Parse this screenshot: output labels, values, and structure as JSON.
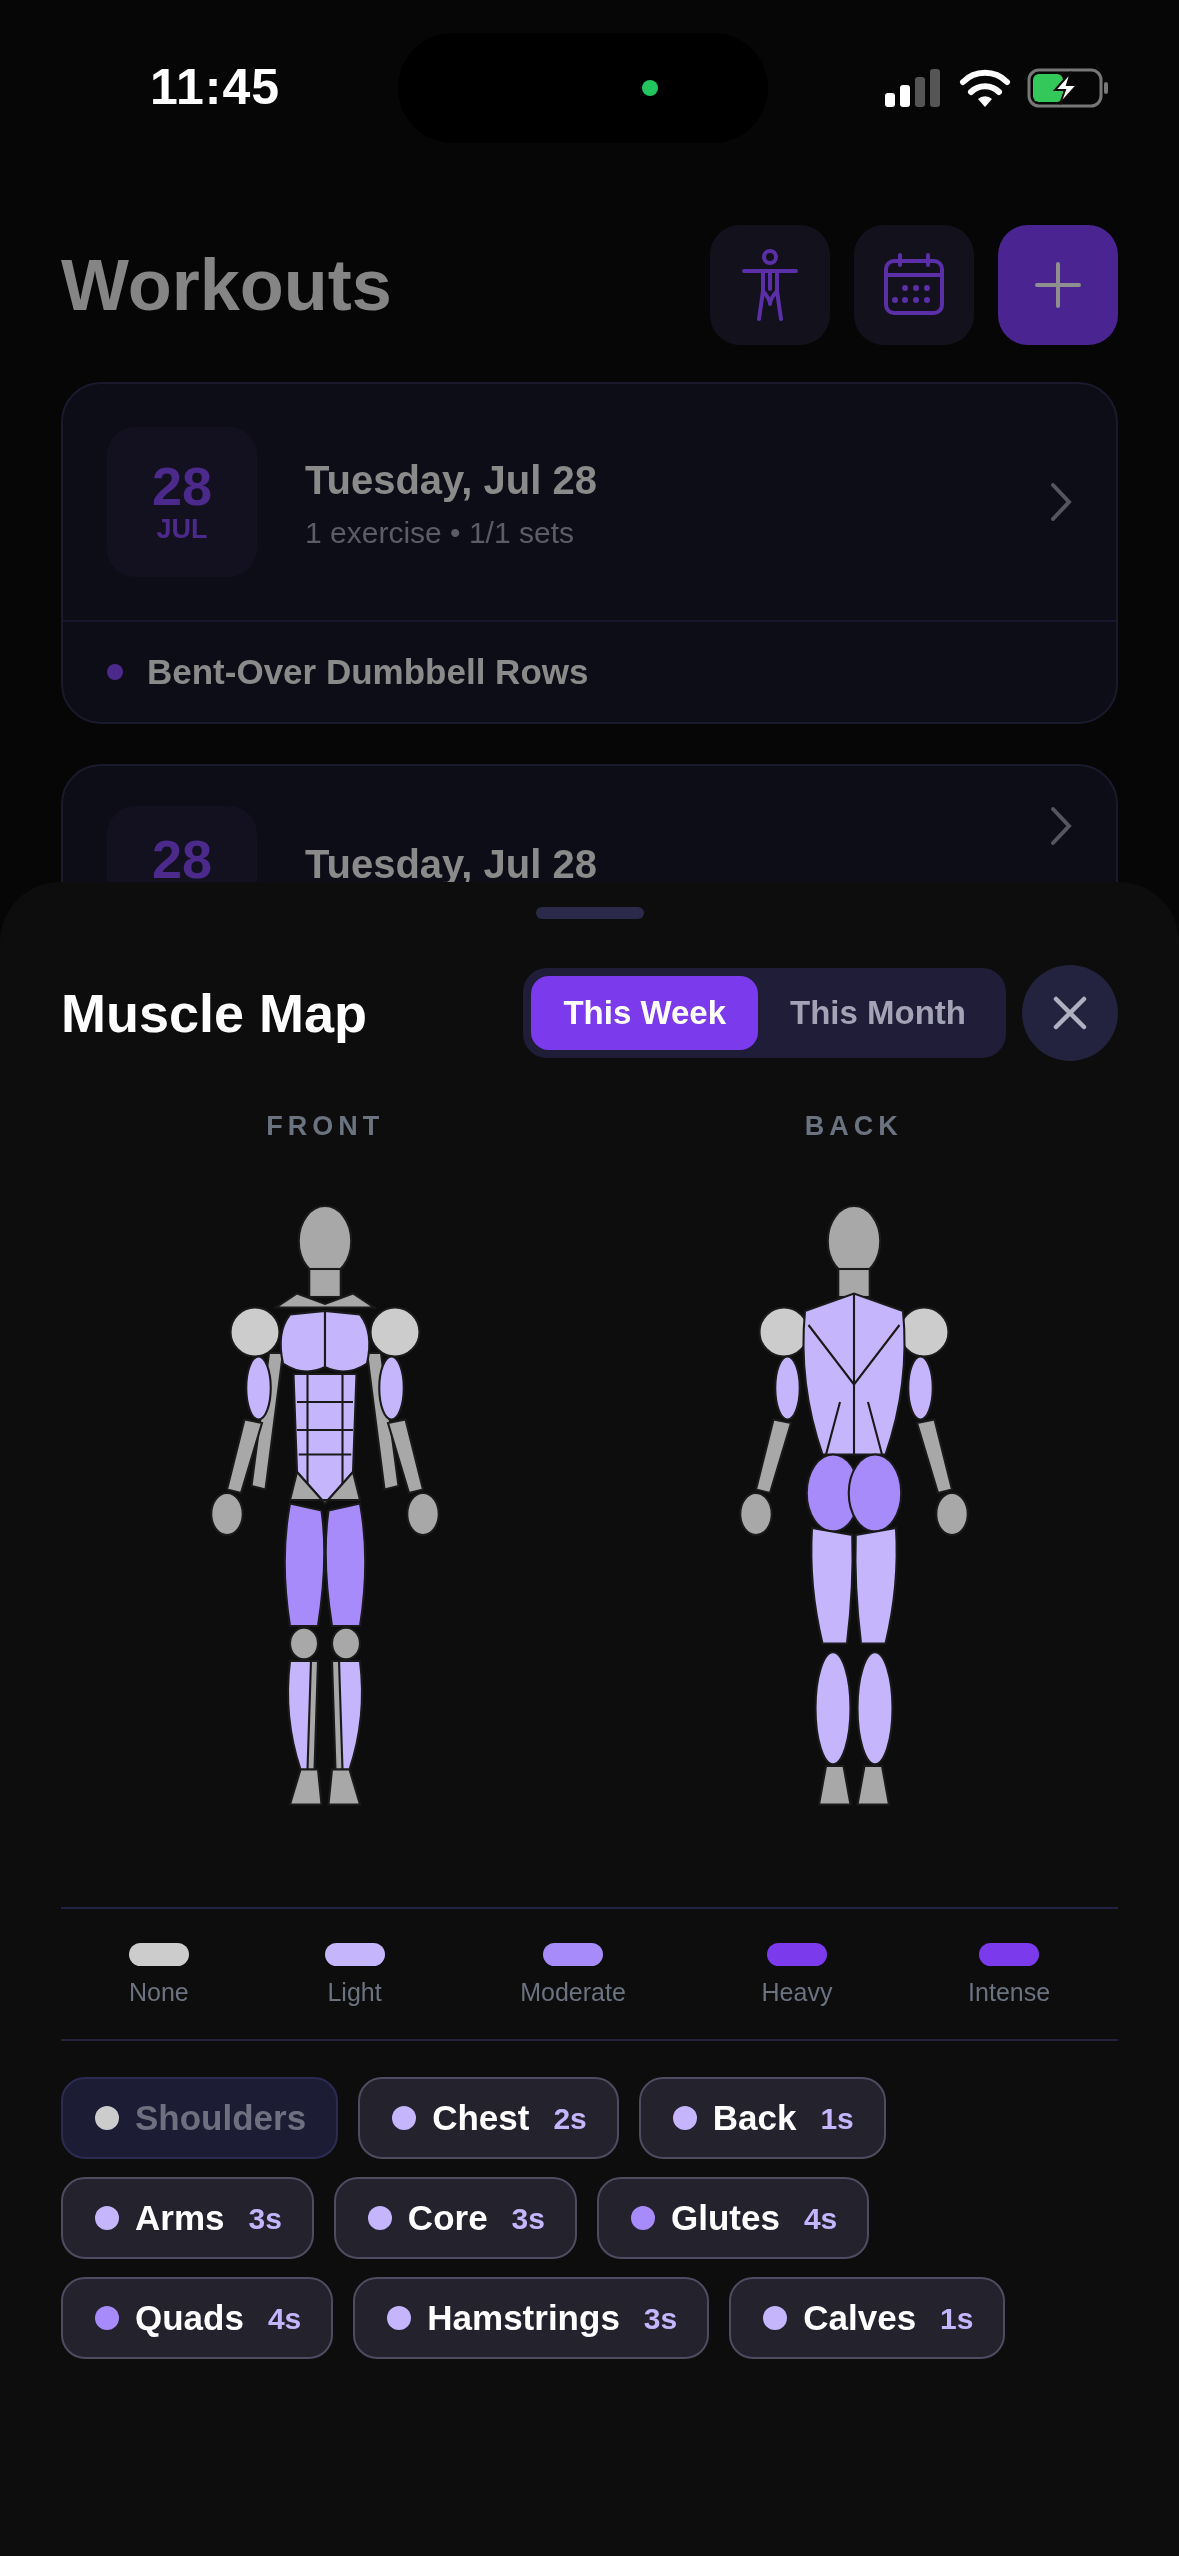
{
  "status_bar": {
    "time": "11:45"
  },
  "header": {
    "title": "Workouts",
    "buttons": [
      {
        "kind": "body"
      },
      {
        "kind": "calendar"
      },
      {
        "kind": "add"
      }
    ]
  },
  "workouts": [
    {
      "day": "28",
      "month": "JUL",
      "title": "Tuesday, Jul 28",
      "summary": "1 exercise • 1/1 sets",
      "exercises": [
        "Bent-Over Dumbbell Rows"
      ]
    },
    {
      "day": "28",
      "title": "Tuesday, Jul 28"
    }
  ],
  "muscle_map": {
    "title": "Muscle Map",
    "tabs": [
      {
        "label": "This Week",
        "selected": true
      },
      {
        "label": "This Month",
        "selected": false
      }
    ],
    "views": [
      "FRONT",
      "BACK"
    ],
    "legend": [
      {
        "label": "None",
        "color": "#cccccc"
      },
      {
        "label": "Light",
        "color": "#c4b5fd"
      },
      {
        "label": "Moderate",
        "color": "#a78bfa"
      },
      {
        "label": "Heavy",
        "color": "#7c3aed"
      },
      {
        "label": "Intense",
        "color": "#7c3aed"
      }
    ],
    "muscles": [
      {
        "name": "Shoulders",
        "color": "#cccccc",
        "trained": false
      },
      {
        "name": "Chest",
        "count": "2s",
        "color": "#c4b5fd",
        "trained": true
      },
      {
        "name": "Back",
        "count": "1s",
        "color": "#c4b5fd",
        "trained": true
      },
      {
        "name": "Arms",
        "count": "3s",
        "color": "#c4b5fd",
        "trained": true
      },
      {
        "name": "Core",
        "count": "3s",
        "color": "#c4b5fd",
        "trained": true
      },
      {
        "name": "Glutes",
        "count": "4s",
        "color": "#a78bfa",
        "trained": true
      },
      {
        "name": "Quads",
        "count": "4s",
        "color": "#a78bfa",
        "trained": true
      },
      {
        "name": "Hamstrings",
        "count": "3s",
        "color": "#c4b5fd",
        "trained": true
      },
      {
        "name": "Calves",
        "count": "1s",
        "color": "#c4b5fd",
        "trained": true
      }
    ]
  }
}
